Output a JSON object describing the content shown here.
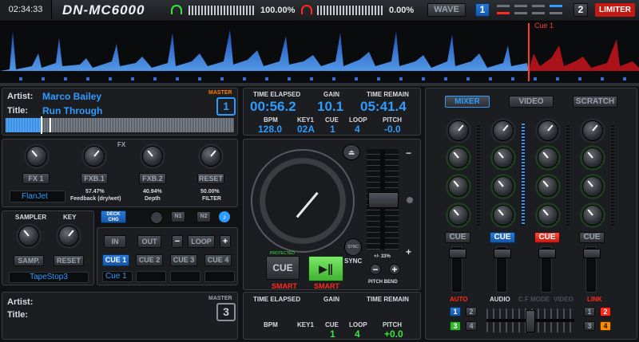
{
  "topbar": {
    "clock": "02:34:33",
    "logo": "DN-MC6000",
    "level_left": "100.00%",
    "level_right": "0.00%",
    "wave_label": "WAVE",
    "deck_left": "1",
    "deck_right": "2",
    "limiter_label": "LIMITER"
  },
  "overview": {
    "cue_marker": "Cue 1"
  },
  "deck1": {
    "artist_label": "Artist:",
    "artist": "Marco Bailey",
    "title_label": "Title:",
    "title": "Run Through",
    "master_label": "MASTER",
    "deck_number": "1",
    "time_elapsed_label": "TIME ELAPSED",
    "time_elapsed": "00:56.2",
    "gain_label": "GAIN",
    "gain": "10.1",
    "time_remain_label": "TIME REMAIN",
    "time_remain": "05:41.4",
    "bpm_label": "BPM",
    "bpm": "128.0",
    "key_label": "KEY1",
    "key": "02A",
    "cue_label": "CUE",
    "cue": "1",
    "loop_label": "LOOP",
    "loop": "4",
    "pitch_label": "PITCH",
    "pitch": "-0.0"
  },
  "fx": {
    "title": "FX",
    "buttons": [
      "FX 1",
      "FXB.1",
      "FXB.2",
      "RESET"
    ],
    "effect_name": "FlanJet",
    "feedback_value": "57.47%",
    "feedback_label": "Feedback (dry/wet)",
    "depth_value": "40.94%",
    "depth_label": "Depth",
    "filter_value": "50.00%",
    "filter_label": "FILTER"
  },
  "sampler": {
    "sampler_label": "SAMPLER",
    "key_label": "KEY",
    "samp_button": "SAMP.",
    "reset_button": "RESET",
    "sample_name": "TapeStop3"
  },
  "deckctrl": {
    "deck_chg_line1": "DECK",
    "deck_chg_line2": "CHG",
    "n1": "N1",
    "n2": "N2"
  },
  "loops": {
    "in": "IN",
    "out": "OUT",
    "minus": "−",
    "loop": "LOOP",
    "plus": "+",
    "cues": [
      "CUE 1",
      "CUE 2",
      "CUE 3",
      "CUE 4"
    ],
    "cue_name": "Cue 1"
  },
  "jog": {
    "protected": "PROTECTED",
    "cue": "CUE",
    "smart1": "SMART",
    "smart2": "SMART",
    "sync": "SYNC",
    "sync_button": "SYNC",
    "pitch_range": "+/- 33%",
    "pitch_bend": "PITCH BEND",
    "minus": "−",
    "plus": "+",
    "slider_minus": "−",
    "slider_plus": "+"
  },
  "deck3": {
    "artist_label": "Artist:",
    "title_label": "Title:",
    "master_label": "MASTER",
    "deck_number": "3",
    "time_elapsed_label": "TIME ELAPSED",
    "gain_label": "GAIN",
    "time_remain_label": "TIME REMAIN",
    "bpm_label": "BPM",
    "key_label": "KEY1",
    "cue_label": "CUE",
    "cue": "1",
    "loop_label": "LOOP",
    "loop": "4",
    "pitch_label": "PITCH",
    "pitch": "+0.0"
  },
  "mixer": {
    "tabs": [
      "MIXER",
      "VIDEO",
      "SCRATCH"
    ],
    "cue_buttons": [
      "CUE",
      "CUE",
      "CUE",
      "CUE"
    ],
    "auto": "AUTO",
    "audio": "AUDIO",
    "cf_mode": "C.F MODE",
    "video": "VIDEO",
    "link": "LINK",
    "left_decks": [
      "1",
      "2",
      "3",
      "4"
    ],
    "right_decks": [
      "1",
      "2",
      "3",
      "4"
    ]
  },
  "colors": {
    "accent_blue": "#2e9bff",
    "accent_green": "#39e63c",
    "accent_red": "#ff2a1c",
    "master_orange": "#ff7a00"
  }
}
